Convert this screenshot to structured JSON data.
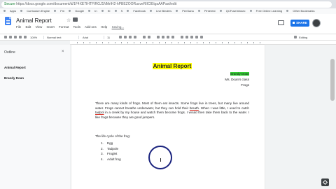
{
  "browser": {
    "secure_label": "Secure",
    "url": "https://docs.google.com/document/d/1F4XE7IHTFIRGJ1NMrlH2-hPBEZOORucveRIICIEtgsAAPaxt/edit",
    "bookmarks": [
      "Apps",
      "Curriculum Engine",
      "Fm",
      "Google",
      "In",
      "EI",
      "S",
      "Facebook",
      "Live Binders",
      "PenSana",
      "Pinterest",
      "QCFuseInfosec",
      "Free Online Learning",
      "Other Bookmarks"
    ]
  },
  "docs": {
    "title": "Animal Report",
    "menu": [
      "File",
      "Edit",
      "View",
      "Insert",
      "Format",
      "Tools",
      "Add-ons",
      "Help"
    ],
    "edit_note": "Saving...",
    "share_label": "SHARE"
  },
  "toolbar": {
    "zoom": "100%",
    "style": "Normal text",
    "font": "Arial",
    "size": "11",
    "mode": "Editing"
  },
  "outline": {
    "title": "Outline",
    "items": [
      "Animal Report",
      "Brandy Doan"
    ]
  },
  "document": {
    "title": "Animal Report",
    "author": "Brandy Doan",
    "class_line": "Ms. Doan's class",
    "subject_line": "Frogs",
    "paragraph_a": "There are many kinds of frogs. Most of them eat insects. Some frogs live in trees, but many live around water. Frogs cannot breathe underwater, but they can hold their ",
    "paragraph_breath": "breath",
    "paragraph_b": ". When I was little, I used to catch ",
    "paragraph_tadpol": "tadpol",
    "paragraph_c": " in a creek by my house and watch them become frogs. I would then take them back to the water. I like frogs because they are good jumpers.",
    "lifecycle_label": "The life cycle of the frog:",
    "lifecycle": [
      {
        "num": "1.",
        "text": "Egg"
      },
      {
        "num": "2.",
        "text": "Tadpole"
      },
      {
        "num": "3.",
        "text": "Froglet"
      },
      {
        "num": "4.",
        "text": "Adult frog"
      }
    ]
  },
  "colors": {
    "title_highlight": "#ffff00",
    "author_highlight": "#32cd32",
    "share_blue": "#1a73e8",
    "cursor_circle": "#1a237e"
  }
}
